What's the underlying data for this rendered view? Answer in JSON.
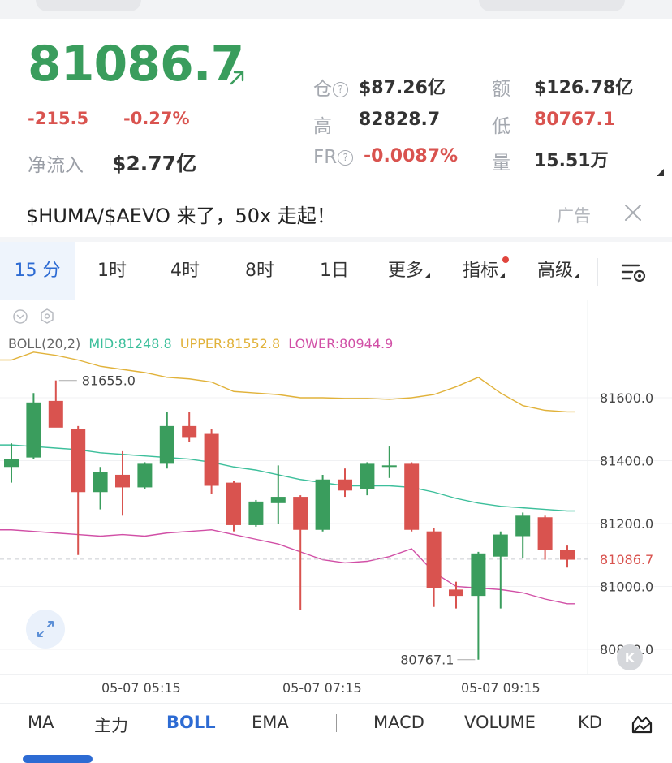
{
  "ticker": {
    "price": "81086.7",
    "change_abs": "-215.5",
    "change_pct": "-0.27%",
    "netflow_label": "净流入",
    "netflow_value": "$2.77亿",
    "stats": [
      {
        "label": "仓",
        "value": "$87.26亿",
        "help": true
      },
      {
        "label": "额",
        "value": "$126.78亿"
      },
      {
        "label": "高",
        "value": "82828.7"
      },
      {
        "label": "低",
        "value": "80767.1",
        "color": "#d9534f"
      },
      {
        "label": "FR",
        "value": "-0.0087%",
        "help": true,
        "color": "#d9534f"
      },
      {
        "label": "量",
        "value": "15.51万"
      }
    ],
    "colors": {
      "up": "#3a9d5d",
      "down": "#d9534f"
    }
  },
  "ad": {
    "text": "$HUMA/$AEVO 来了，50x 走起！",
    "label": "广告",
    "close_icon": "close-icon"
  },
  "intervals": [
    {
      "label": "15 分",
      "active": true
    },
    {
      "label": "1时"
    },
    {
      "label": "4时"
    },
    {
      "label": "8时"
    },
    {
      "label": "1日"
    },
    {
      "label": "更多",
      "dropdown": true
    },
    {
      "label": "指标",
      "dropdown": true,
      "dot": true
    },
    {
      "label": "高级",
      "dropdown": true
    }
  ],
  "settings_icon": "chart-settings-icon",
  "chart_data": {
    "type": "candlestick",
    "indicator": {
      "name": "BOLL(20,2)",
      "mid_label": "MID:81248.8",
      "upper_label": "UPPER:81552.8",
      "lower_label": "LOWER:80944.9",
      "colors": {
        "mid": "#3cbf9b",
        "upper": "#e1b23a",
        "lower": "#d14fa6"
      }
    },
    "y_ticks": [
      "81600.0",
      "81400.0",
      "81200.0",
      "81000.0",
      "80800.0"
    ],
    "y_tick_values": [
      81600,
      81400,
      81200,
      81000,
      80800
    ],
    "ylim": [
      80750,
      81800
    ],
    "current_price_label": "81086.7",
    "current_price": 81086.7,
    "high_marker": {
      "label": "81655.0",
      "value": 81655.0,
      "index": 2
    },
    "low_marker": {
      "label": "80767.1",
      "value": 80767.1,
      "index": 21
    },
    "x_labels": [
      "05-07 05:15",
      "05-07 07:15",
      "05-07 09:15"
    ],
    "x_label_index": [
      6,
      14,
      22
    ],
    "candles": [
      {
        "o": 81380,
        "h": 81455,
        "l": 81330,
        "c": 81405
      },
      {
        "o": 81410,
        "h": 81615,
        "l": 81405,
        "c": 81585
      },
      {
        "o": 81590,
        "h": 81655,
        "l": 81580,
        "c": 81505
      },
      {
        "o": 81500,
        "h": 81510,
        "l": 81100,
        "c": 81300
      },
      {
        "o": 81300,
        "h": 81380,
        "l": 81245,
        "c": 81365
      },
      {
        "o": 81355,
        "h": 81430,
        "l": 81225,
        "c": 81315
      },
      {
        "o": 81315,
        "h": 81395,
        "l": 81310,
        "c": 81390
      },
      {
        "o": 81390,
        "h": 81555,
        "l": 81375,
        "c": 81510
      },
      {
        "o": 81510,
        "h": 81555,
        "l": 81460,
        "c": 81475
      },
      {
        "o": 81485,
        "h": 81500,
        "l": 81295,
        "c": 81320
      },
      {
        "o": 81330,
        "h": 81335,
        "l": 81175,
        "c": 81195
      },
      {
        "o": 81195,
        "h": 81275,
        "l": 81190,
        "c": 81270
      },
      {
        "o": 81265,
        "h": 81385,
        "l": 81200,
        "c": 81285
      },
      {
        "o": 81285,
        "h": 81290,
        "l": 80925,
        "c": 81180
      },
      {
        "o": 81180,
        "h": 81355,
        "l": 81175,
        "c": 81340
      },
      {
        "o": 81340,
        "h": 81375,
        "l": 81285,
        "c": 81305
      },
      {
        "o": 81310,
        "h": 81395,
        "l": 81290,
        "c": 81390
      },
      {
        "o": 81385,
        "h": 81445,
        "l": 81345,
        "c": 81385
      },
      {
        "o": 81390,
        "h": 81395,
        "l": 81175,
        "c": 81180
      },
      {
        "o": 81175,
        "h": 81185,
        "l": 80935,
        "c": 80995
      },
      {
        "o": 80990,
        "h": 81015,
        "l": 80930,
        "c": 80970
      },
      {
        "o": 80970,
        "h": 81110,
        "l": 80767.1,
        "c": 81105
      },
      {
        "o": 81095,
        "h": 81175,
        "l": 80930,
        "c": 81165
      },
      {
        "o": 81160,
        "h": 81235,
        "l": 81090,
        "c": 81225
      },
      {
        "o": 81220,
        "h": 81225,
        "l": 81085,
        "c": 81115
      },
      {
        "o": 81115,
        "h": 81130,
        "l": 81060,
        "c": 81085
      }
    ],
    "mid": [
      81450,
      81445,
      81440,
      81435,
      81425,
      81420,
      81415,
      81410,
      81405,
      81395,
      81380,
      81370,
      81355,
      81340,
      81330,
      81320,
      81320,
      81320,
      81315,
      81300,
      81280,
      81265,
      81255,
      81250,
      81245,
      81240
    ],
    "upper": [
      81720,
      81745,
      81735,
      81720,
      81700,
      81690,
      81680,
      81665,
      81660,
      81650,
      81620,
      81615,
      81610,
      81600,
      81600,
      81598,
      81598,
      81595,
      81600,
      81610,
      81635,
      81665,
      81615,
      81575,
      81560,
      81555
    ],
    "lower": [
      81180,
      81175,
      81170,
      81165,
      81160,
      81165,
      81160,
      81170,
      81175,
      81180,
      81165,
      81150,
      81135,
      81110,
      81085,
      81075,
      81080,
      81095,
      81120,
      81045,
      81000,
      80995,
      80990,
      80980,
      80960,
      80945
    ]
  },
  "bottom_tabs": [
    {
      "label": "MA"
    },
    {
      "label": "主力"
    },
    {
      "label": "BOLL",
      "active": true
    },
    {
      "label": "EMA"
    },
    {
      "label": "MACD"
    },
    {
      "label": "VOLUME"
    },
    {
      "label": "KD"
    }
  ]
}
